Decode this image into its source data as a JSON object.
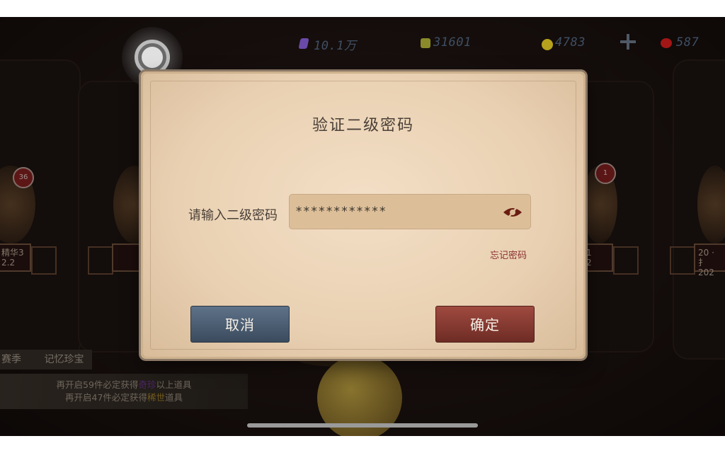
{
  "resources": {
    "gem": "10.1万",
    "puzzle": "31601",
    "coin": "4783",
    "ruby": "587"
  },
  "background": {
    "left_badge": "36",
    "right_badge": "1",
    "left_ribbon_line1": "精华3",
    "left_ribbon_line2": "2.2",
    "mid_right_ribbon_line1": "1",
    "mid_right_ribbon_line2": "2",
    "right_ribbon_line1": "20 · 扌",
    "right_ribbon_line2": "202",
    "season_tab": "赛季",
    "memory_tab": "记忆珍宝",
    "pity_line1_prefix": "再开启59件必定获得",
    "pity_line1_rarity": "奇珍",
    "pity_line1_suffix": "以上道具",
    "pity_line2_prefix": "再开启47件必定获得",
    "pity_line2_rarity": "稀世",
    "pity_line2_suffix": "道具"
  },
  "dialog": {
    "title": "验证二级密码",
    "password_label": "请输入二级密码",
    "password_value": "************",
    "forgot_link": "忘记密码",
    "cancel_label": "取消",
    "confirm_label": "确定"
  },
  "colors": {
    "cancel_button": "#4a5c70",
    "confirm_button": "#8a3a30",
    "rare_text": "#7a3aa0",
    "legend_text": "#b08a2a"
  }
}
